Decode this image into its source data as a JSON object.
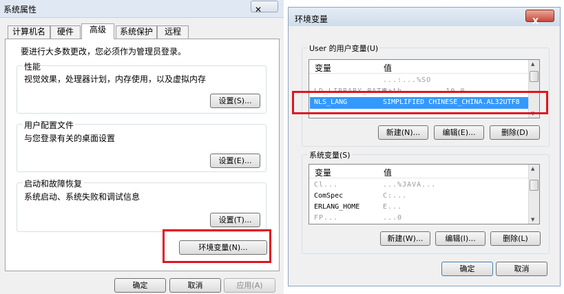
{
  "left_dialog": {
    "title": "系统属性",
    "close_glyph": "✕",
    "tabs": [
      {
        "label": "计算机名"
      },
      {
        "label": "硬件"
      },
      {
        "label": "高级"
      },
      {
        "label": "系统保护"
      },
      {
        "label": "远程"
      }
    ],
    "notice": "要进行大多数更改，您必须作为管理员登录。",
    "performance": {
      "label": "性能",
      "desc": "视觉效果，处理器计划，内存使用，以及虚拟内存",
      "button": "设置(S)..."
    },
    "user_profiles": {
      "label": "用户配置文件",
      "desc": "与您登录有关的桌面设置",
      "button": "设置(E)..."
    },
    "startup_recovery": {
      "label": "启动和故障恢复",
      "desc": "系统启动、系统失败和调试信息",
      "button": "设置(T)..."
    },
    "env_button": "环境变量(N)...",
    "ok": "确定",
    "cancel": "取消",
    "apply": "应用(A)"
  },
  "right_dialog": {
    "title": "环境变量",
    "close_glyph": "X",
    "user_section": {
      "label": "User 的用户变量(U)",
      "col_variable": "变量",
      "col_value": "值",
      "rows": [
        {
          "name": "",
          "value": "...:...%SO"
        },
        {
          "name": "LD_LIBRARY_PATH",
          "value": "Path ... ... 10.0"
        },
        {
          "name": "NLS_LANG",
          "value": "SIMPLIFIED CHINESE_CHINA.AL32UTF8",
          "selected": true
        },
        {
          "name": "",
          "value": ""
        }
      ],
      "new": "新建(N)...",
      "edit": "编辑(E)...",
      "delete": "删除(D)"
    },
    "system_section": {
      "label": "系统变量(S)",
      "col_variable": "变量",
      "col_value": "值",
      "rows": [
        {
          "name": "Cl...",
          "value": "...%JAVA..."
        },
        {
          "name": "ComSpec",
          "value": "C:..."
        },
        {
          "name": "ERLANG_HOME",
          "value": "E..."
        },
        {
          "name": "FP...",
          "value": "...0"
        }
      ],
      "new": "新建(W)...",
      "edit": "编辑(I)...",
      "delete": "删除(L)"
    },
    "ok": "确定",
    "cancel": "取消"
  },
  "colors": {
    "highlight_red": "#e0141e",
    "selection_blue": "#3399ff"
  }
}
